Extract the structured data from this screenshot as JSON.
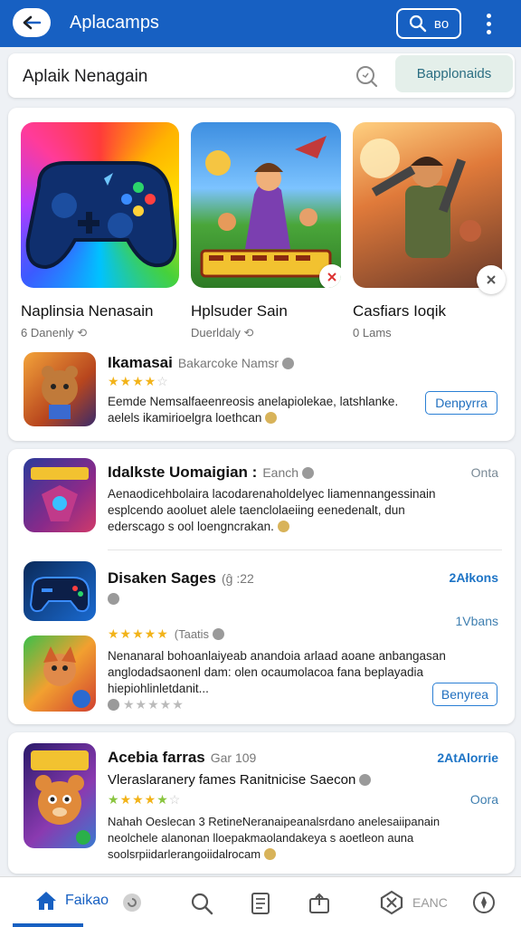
{
  "appbar": {
    "title": "Aplacamps",
    "search_label": "ʙo",
    "back_icon": "back-arrow-icon",
    "menu_icon": "more-vertical-icon",
    "bg": "#1760c2"
  },
  "search": {
    "text": "Aplaik Nenagain",
    "chip_label": "Bapplonaids"
  },
  "featured": [
    {
      "title": "Naplinsia Nenasain",
      "sub": "Danenly",
      "sub_num": "6"
    },
    {
      "title": "Hplsuder Sain",
      "sub": "Duerldaly"
    },
    {
      "title": "Casfiars Ioqik",
      "sub": "Lams",
      "sub_num": "0"
    }
  ],
  "card1_item": {
    "name": "Ikamasai",
    "meta": "Bakarcoke Namsr",
    "desc_line1": "Eemde Nemsalfaeenreosis anelapiolekae, latshlanke.",
    "desc_line2": "aelels ikamirioelgra loethcan",
    "button": "Denpyrra"
  },
  "list": [
    {
      "name": "Idalkste Uomaigian :",
      "meta": "Eanch",
      "right": "Onta",
      "desc_line1": "Aenaodicehbolaira lacodarenaholdelyec liamennangessinain",
      "desc_line2": "esplcendo aooluet alele taenclolaeiing eenedenalt, dun",
      "desc_line3": "ederscago s ool loengncrakan."
    },
    {
      "name": "Disaken Sages",
      "meta": "(ĝ :22",
      "right": "2Ałkons",
      "right2": "1Vbans",
      "stars_label": "(Taatis",
      "desc_line1": "Nenanaral bohoanlaiyeab anandoia arlaad aoane anbangasan",
      "desc_line2": "anglodadsaonenl dam: olen ocaumolacoa fana beplayadia",
      "desc_line3": "hiepiohlinletdanit...",
      "button": "Benyrea"
    },
    {
      "name": "Acebia farras",
      "meta": "Gar 109",
      "right": "2AtAlorrie",
      "right2": "Oora",
      "subtitle": "Vleraslaranery fames Ranitnicise Saecon",
      "desc_line1": "Nahah Oeslecan 3 RetineNeranaipeanalsrdano anelesaiipanain",
      "desc_line2": "neolchele alanonan lloepakmaolandakeya s aoetleon auna",
      "desc_line3": "soolsrpiidarlerangoiidalrocam"
    }
  ],
  "bottom_nav": {
    "home_label": "Faikao",
    "right_label": "EANC"
  },
  "colors": {
    "accent": "#1760c2",
    "star": "#f2b319",
    "link": "#1d74c6"
  }
}
